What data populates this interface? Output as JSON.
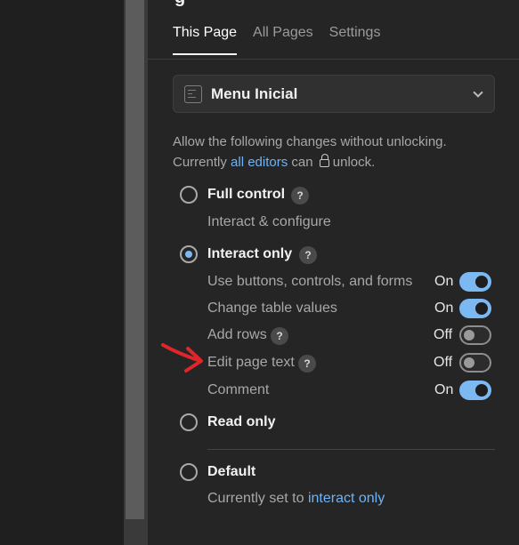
{
  "page_title_fragment": "g",
  "tabs": [
    {
      "label": "This Page",
      "active": true
    },
    {
      "label": "All Pages",
      "active": false
    },
    {
      "label": "Settings",
      "active": false
    }
  ],
  "page_select": {
    "label": "Menu Inicial",
    "icon": "page-icon"
  },
  "description": {
    "line1": "Allow the following changes without unlocking.",
    "prefix": "Currently ",
    "link": "all editors",
    "middle": " can ",
    "suffix": "unlock."
  },
  "options": {
    "full_control": {
      "label": "Full control",
      "help": "?",
      "sub": "Interact & configure",
      "checked": false
    },
    "interact_only": {
      "label": "Interact only",
      "help": "?",
      "checked": true
    },
    "read_only": {
      "label": "Read only",
      "checked": false
    },
    "default": {
      "label": "Default",
      "sub_prefix": "Currently set to ",
      "sub_link": "interact only",
      "checked": false
    }
  },
  "settings": [
    {
      "label": "Use buttons, controls, and forms",
      "state": "On",
      "on": true,
      "help": null
    },
    {
      "label": "Change table values",
      "state": "On",
      "on": true,
      "help": null
    },
    {
      "label": "Add rows",
      "state": "Off",
      "on": false,
      "help": "?"
    },
    {
      "label": "Edit page text",
      "state": "Off",
      "on": false,
      "help": "?"
    },
    {
      "label": "Comment",
      "state": "On",
      "on": true,
      "help": null
    }
  ],
  "colors": {
    "accent": "#7cb8f2",
    "link": "#6fb3f5",
    "annotation": "#e0262a"
  }
}
